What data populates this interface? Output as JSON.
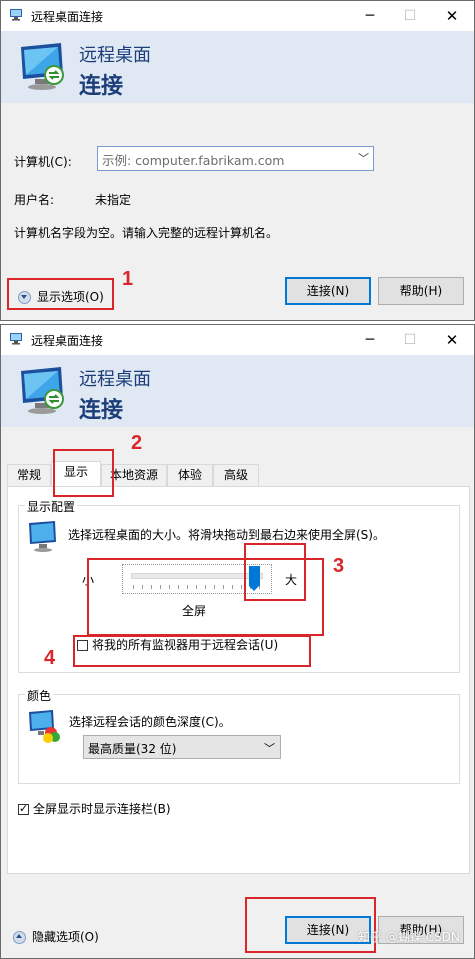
{
  "window1": {
    "title": "远程桌面连接",
    "banner": {
      "line1": "远程桌面",
      "line2": "连接"
    },
    "computer_label": "计算机(C):",
    "computer_placeholder": "示例: computer.fabrikam.com",
    "username_label": "用户名:",
    "username_value": "未指定",
    "message": "计算机名字段为空。请输入完整的远程计算机名。",
    "show_options": "显示选项(O)",
    "connect": "连接(N)",
    "help": "帮助(H)"
  },
  "window2": {
    "title": "远程桌面连接",
    "banner": {
      "line1": "远程桌面",
      "line2": "连接"
    },
    "tabs": [
      "常规",
      "显示",
      "本地资源",
      "体验",
      "高级"
    ],
    "active_tab": "显示",
    "display_group": {
      "title": "显示配置",
      "desc": "选择远程桌面的大小。将滑块拖动到最右边来使用全屏(S)。",
      "slider_small": "小",
      "slider_large": "大",
      "slider_value_label": "全屏",
      "slider_level": 1.0,
      "all_monitors": "将我的所有监视器用于远程会话(U)",
      "all_monitors_checked": false
    },
    "color_group": {
      "title": "颜色",
      "desc": "选择远程会话的颜色深度(C)。",
      "selected": "最高质量(32 位)"
    },
    "connection_bar": "全屏显示时显示连接栏(B)",
    "connection_bar_checked": true,
    "hide_options": "隐藏选项(O)",
    "connect": "连接(N)",
    "help": "帮助(H)"
  },
  "annotations": [
    "1",
    "2",
    "3",
    "4"
  ],
  "watermark": "知乎 @蝴蝶 CSDN",
  "colors": {
    "annotation_red": "#d9262b",
    "banner_blue": "#1c3f7a",
    "accent": "#0078d7"
  }
}
